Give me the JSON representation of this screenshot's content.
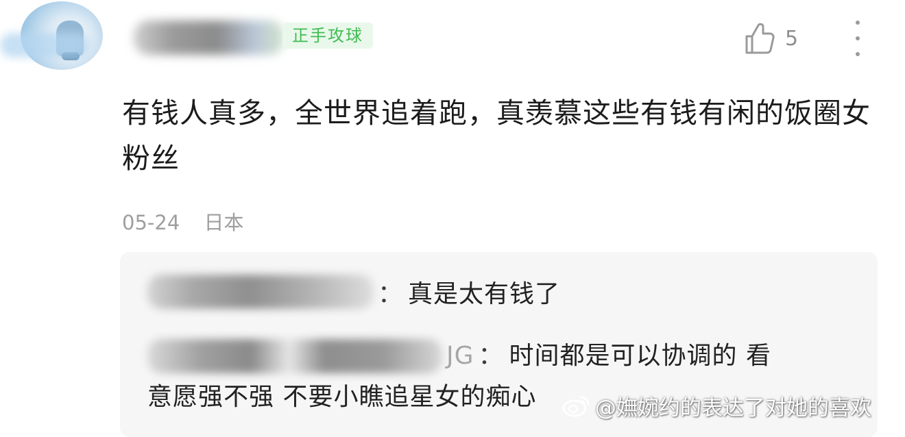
{
  "comment": {
    "badge": "正手攻球",
    "like_count": "5",
    "text": "有钱人真多，全世界追着跑，真羡慕这些有钱有闲的饭圈女粉丝",
    "date": "05-24",
    "location": "日本"
  },
  "replies": [
    {
      "name_prefix": "走",
      "name_suffix": "m_    _田",
      "colon": "：",
      "text": "真是太有钱了"
    },
    {
      "name_prefix": "",
      "name_suffix": "JG",
      "colon": "：",
      "text_line1": "时间都是可以协调的 看",
      "text_line2": "意愿强不强 不要小瞧追星女的痴心"
    }
  ],
  "watermark": {
    "text": "@嫵婉约的表达了对她的喜欢"
  },
  "icons": {
    "like": "thumbs-up-icon",
    "more": "more-vertical-icon",
    "watermark": "weibo-logo-icon"
  },
  "colors": {
    "badge_text": "#3fbc53",
    "badge_bg": "#e9f8ea",
    "meta_text": "#9e9e9e",
    "reply_bg": "#f6f6f6"
  }
}
